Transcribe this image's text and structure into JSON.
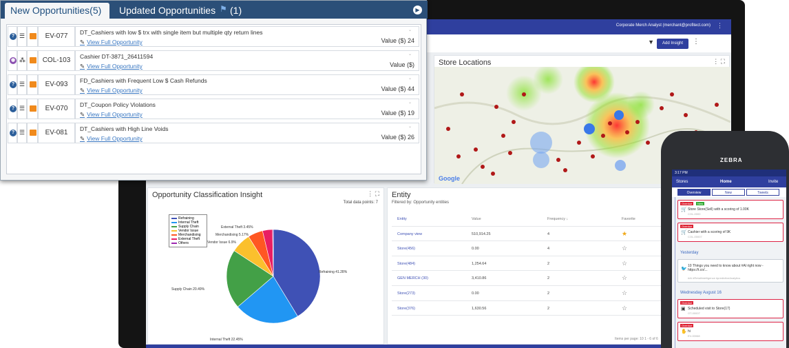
{
  "overlay": {
    "tabs": [
      {
        "label": "New Opportunities(5)"
      },
      {
        "label": "Updated Opportunities"
      }
    ],
    "updated_count": "(1)",
    "rows": [
      {
        "id": "EV-077",
        "title": "DT_Cashiers with low $ trx with single item but multiple qty return lines",
        "link": "View Full Opportunity",
        "value": "Value ($) 24",
        "kind": "question"
      },
      {
        "id": "COL-103",
        "title": "Cashier DT-3871_26411594",
        "link": "View Full Opportunity",
        "value": "Value ($)",
        "kind": "collection"
      },
      {
        "id": "EV-093",
        "title": "FD_Cashiers with Frequent Low $ Cash Refunds",
        "link": "View Full Opportunity",
        "value": "Value ($) 44",
        "kind": "question"
      },
      {
        "id": "EV-070",
        "title": "DT_Coupon Policy Violations",
        "link": "View Full Opportunity",
        "value": "Value ($) 19",
        "kind": "question"
      },
      {
        "id": "EV-081",
        "title": "DT_Cashiers with High Line Voids",
        "link": "View Full Opportunity",
        "value": "Value ($) 26",
        "kind": "question"
      }
    ]
  },
  "dashboard": {
    "user": "Corporate Merch Analyst (merchant@profitect.com)",
    "add_insight": "Add Insight",
    "map_title": "Store Locations",
    "class_title": "Opportunity Classification Insight",
    "total_points": "Total data points: 7",
    "entity_title": "Entity",
    "entity_filter": "Filtered by: Opportunity entities",
    "entity_headers": [
      "Entity",
      "Value",
      "Frequency ↓",
      "Favorite"
    ],
    "entity_rows": [
      {
        "entity": "Company view",
        "value": "510,914.25",
        "frequency": "4",
        "fav": "★"
      },
      {
        "entity": "Store(456)",
        "value": "0.00",
        "frequency": "4",
        "fav": "☆"
      },
      {
        "entity": "Store(484)",
        "value": "1,254.64",
        "frequency": "2",
        "fav": "☆"
      },
      {
        "entity": "GEN MERCH (30)",
        "value": "3,410.86",
        "frequency": "2",
        "fav": "☆"
      },
      {
        "entity": "Store(273)",
        "value": "0.00",
        "frequency": "2",
        "fav": "☆"
      },
      {
        "entity": "Store(376)",
        "value": "1,630.56",
        "frequency": "2",
        "fav": "☆"
      }
    ],
    "pager": "Items per page: 10     1 - 6 of 6"
  },
  "chart_data": {
    "type": "pie",
    "title": "Opportunity Classification Insight",
    "slices": [
      {
        "name": "Refraining",
        "value": 41.28,
        "color": "#3f51b5",
        "label": "Refraining 41.28%"
      },
      {
        "name": "Internal Theft",
        "value": 22.45,
        "color": "#2196f3",
        "label": "Internal Theft 22.45%"
      },
      {
        "name": "Supply Chain",
        "value": 20.49,
        "color": "#43a047",
        "label": "Supply Chain 20.49%"
      },
      {
        "name": "Vendor Issue",
        "value": 6.9,
        "color": "#fbc02d",
        "label": "Vendor Issue 6.9%"
      },
      {
        "name": "Merchandising",
        "value": 5.17,
        "color": "#ff5722",
        "label": "Merchandising 5.17%"
      },
      {
        "name": "External Theft",
        "value": 3.45,
        "color": "#e91e63",
        "label": "External Theft 3.45%"
      },
      {
        "name": "Others",
        "value": 0.26,
        "color": "#9c27b0",
        "label": ""
      }
    ],
    "legend": [
      "Refraining",
      "Internal Theft",
      "Supply Chain",
      "Vendor Issue",
      "Merchandising",
      "External Theft",
      "Others"
    ]
  },
  "phone": {
    "brand": "ZEBRA",
    "status": "3:17 PM",
    "nav": [
      "Stores",
      "Home",
      "Invite"
    ],
    "tabs": [
      "Overview",
      "New",
      "Tweets"
    ],
    "cards": [
      {
        "badge": "Overdue",
        "badge2": "New",
        "text": "Store Store(Sell) with a scoring of 1.00K",
        "sub": "COL-0000"
      },
      {
        "badge": "Overdue",
        "text": "Cashier with a scoring of 9K",
        "sub": "COL-00007"
      },
      {
        "badge": "",
        "text": "10 Things you need to know about #Al right now - https://t.co/...",
        "sub": "#AI #RetailIntelligence #predictiveAnalytics"
      },
      {
        "badge": "Overdue",
        "text": "Scheduled visit to Store(17)",
        "sub": "OT-00007"
      },
      {
        "badge": "Overdue",
        "text": "hi",
        "sub": "EV-00068"
      }
    ],
    "dates": [
      "Yesterday",
      "Wednesday August 16"
    ]
  },
  "colors": {
    "header": "#2b4f78",
    "primary": "#2f3f9e",
    "link": "#3a78c2",
    "folder": "#f08a1c"
  }
}
